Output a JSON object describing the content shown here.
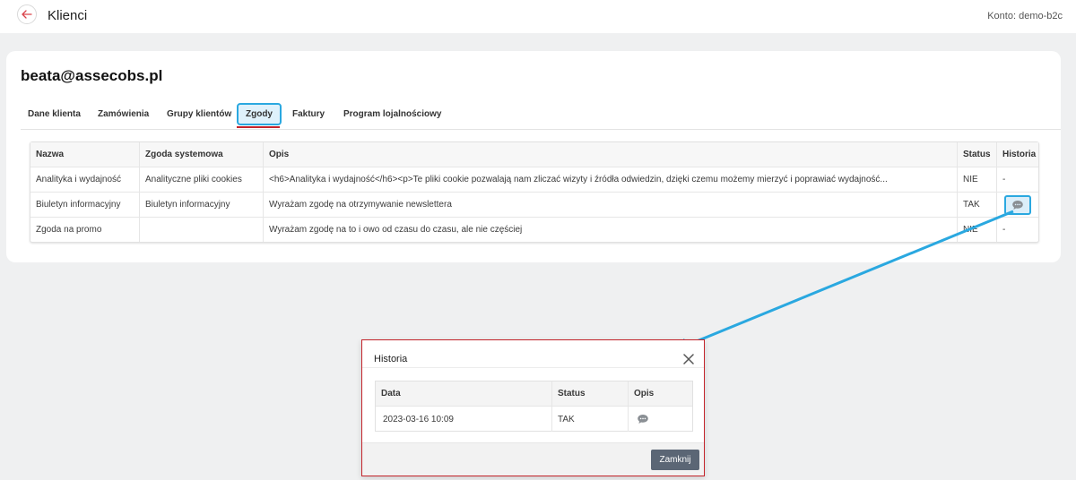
{
  "topbar": {
    "title": "Klienci",
    "account": "Konto: demo-b2c"
  },
  "card": {
    "title": "beata@assecobs.pl"
  },
  "tabs": [
    {
      "label": "Dane klienta"
    },
    {
      "label": "Zamówienia"
    },
    {
      "label": "Grupy klientów"
    },
    {
      "label": "Zgody",
      "active": true
    },
    {
      "label": "Faktury"
    },
    {
      "label": "Program lojalnościowy"
    }
  ],
  "consents": {
    "headers": [
      "Nazwa",
      "Zgoda systemowa",
      "Opis",
      "Status",
      "Historia"
    ],
    "rows": [
      {
        "name": "Analityka i wydajność",
        "system": "Analityczne pliki cookies",
        "desc": "<h6>Analityka i wydajność</h6><p>Te pliki cookie pozwalają nam zliczać wizyty i źródła odwiedzin, dzięki czemu możemy mierzyć i poprawiać wydajność...",
        "status": "NIE",
        "history": "-"
      },
      {
        "name": "Biuletyn informacyjny",
        "system": "Biuletyn informacyjny",
        "desc": "Wyrażam zgodę na otrzymywanie newslettera",
        "status": "TAK",
        "history": ""
      },
      {
        "name": "Zgoda na promo",
        "system": "",
        "desc": "Wyrażam zgodę na to i owo od czasu do czasu, ale nie częściej",
        "status": "NIE",
        "history": "-"
      }
    ]
  },
  "modal": {
    "title": "Historia",
    "headers": [
      "Data",
      "Status",
      "Opis"
    ],
    "rows": [
      {
        "date": "2023-03-16 10:09",
        "status": "TAK"
      }
    ],
    "close_label": "Zamknij"
  },
  "colors": {
    "accent": "#2aa8e0",
    "active_underline": "#c4242b",
    "modal_border": "#c4242b",
    "close_button": "#5b6675"
  },
  "icons": {
    "back": "arrow-left-icon",
    "history": "comment-icon",
    "close": "close-icon"
  }
}
